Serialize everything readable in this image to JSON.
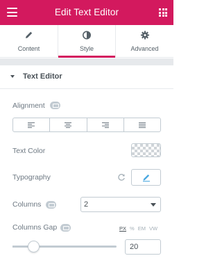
{
  "header": {
    "title": "Edit Text Editor"
  },
  "tabs": [
    {
      "label": "Content",
      "icon": "pencil-icon",
      "active": false
    },
    {
      "label": "Style",
      "icon": "contrast-icon",
      "active": true
    },
    {
      "label": "Advanced",
      "icon": "gear-icon",
      "active": false
    }
  ],
  "section": {
    "title": "Text Editor"
  },
  "alignment": {
    "label": "Alignment",
    "options": [
      "left",
      "center",
      "right",
      "justify"
    ]
  },
  "text_color": {
    "label": "Text Color"
  },
  "typography": {
    "label": "Typography"
  },
  "columns": {
    "label": "Columns",
    "value": "2"
  },
  "columns_gap": {
    "label": "Columns Gap",
    "units": [
      "PX",
      "%",
      "EM",
      "VW"
    ],
    "active_unit": "PX",
    "value": "20",
    "slider_fraction": 0.2
  },
  "colors": {
    "accent": "#d3195e",
    "border": "#c2cbd2",
    "text": "#6d7882"
  }
}
